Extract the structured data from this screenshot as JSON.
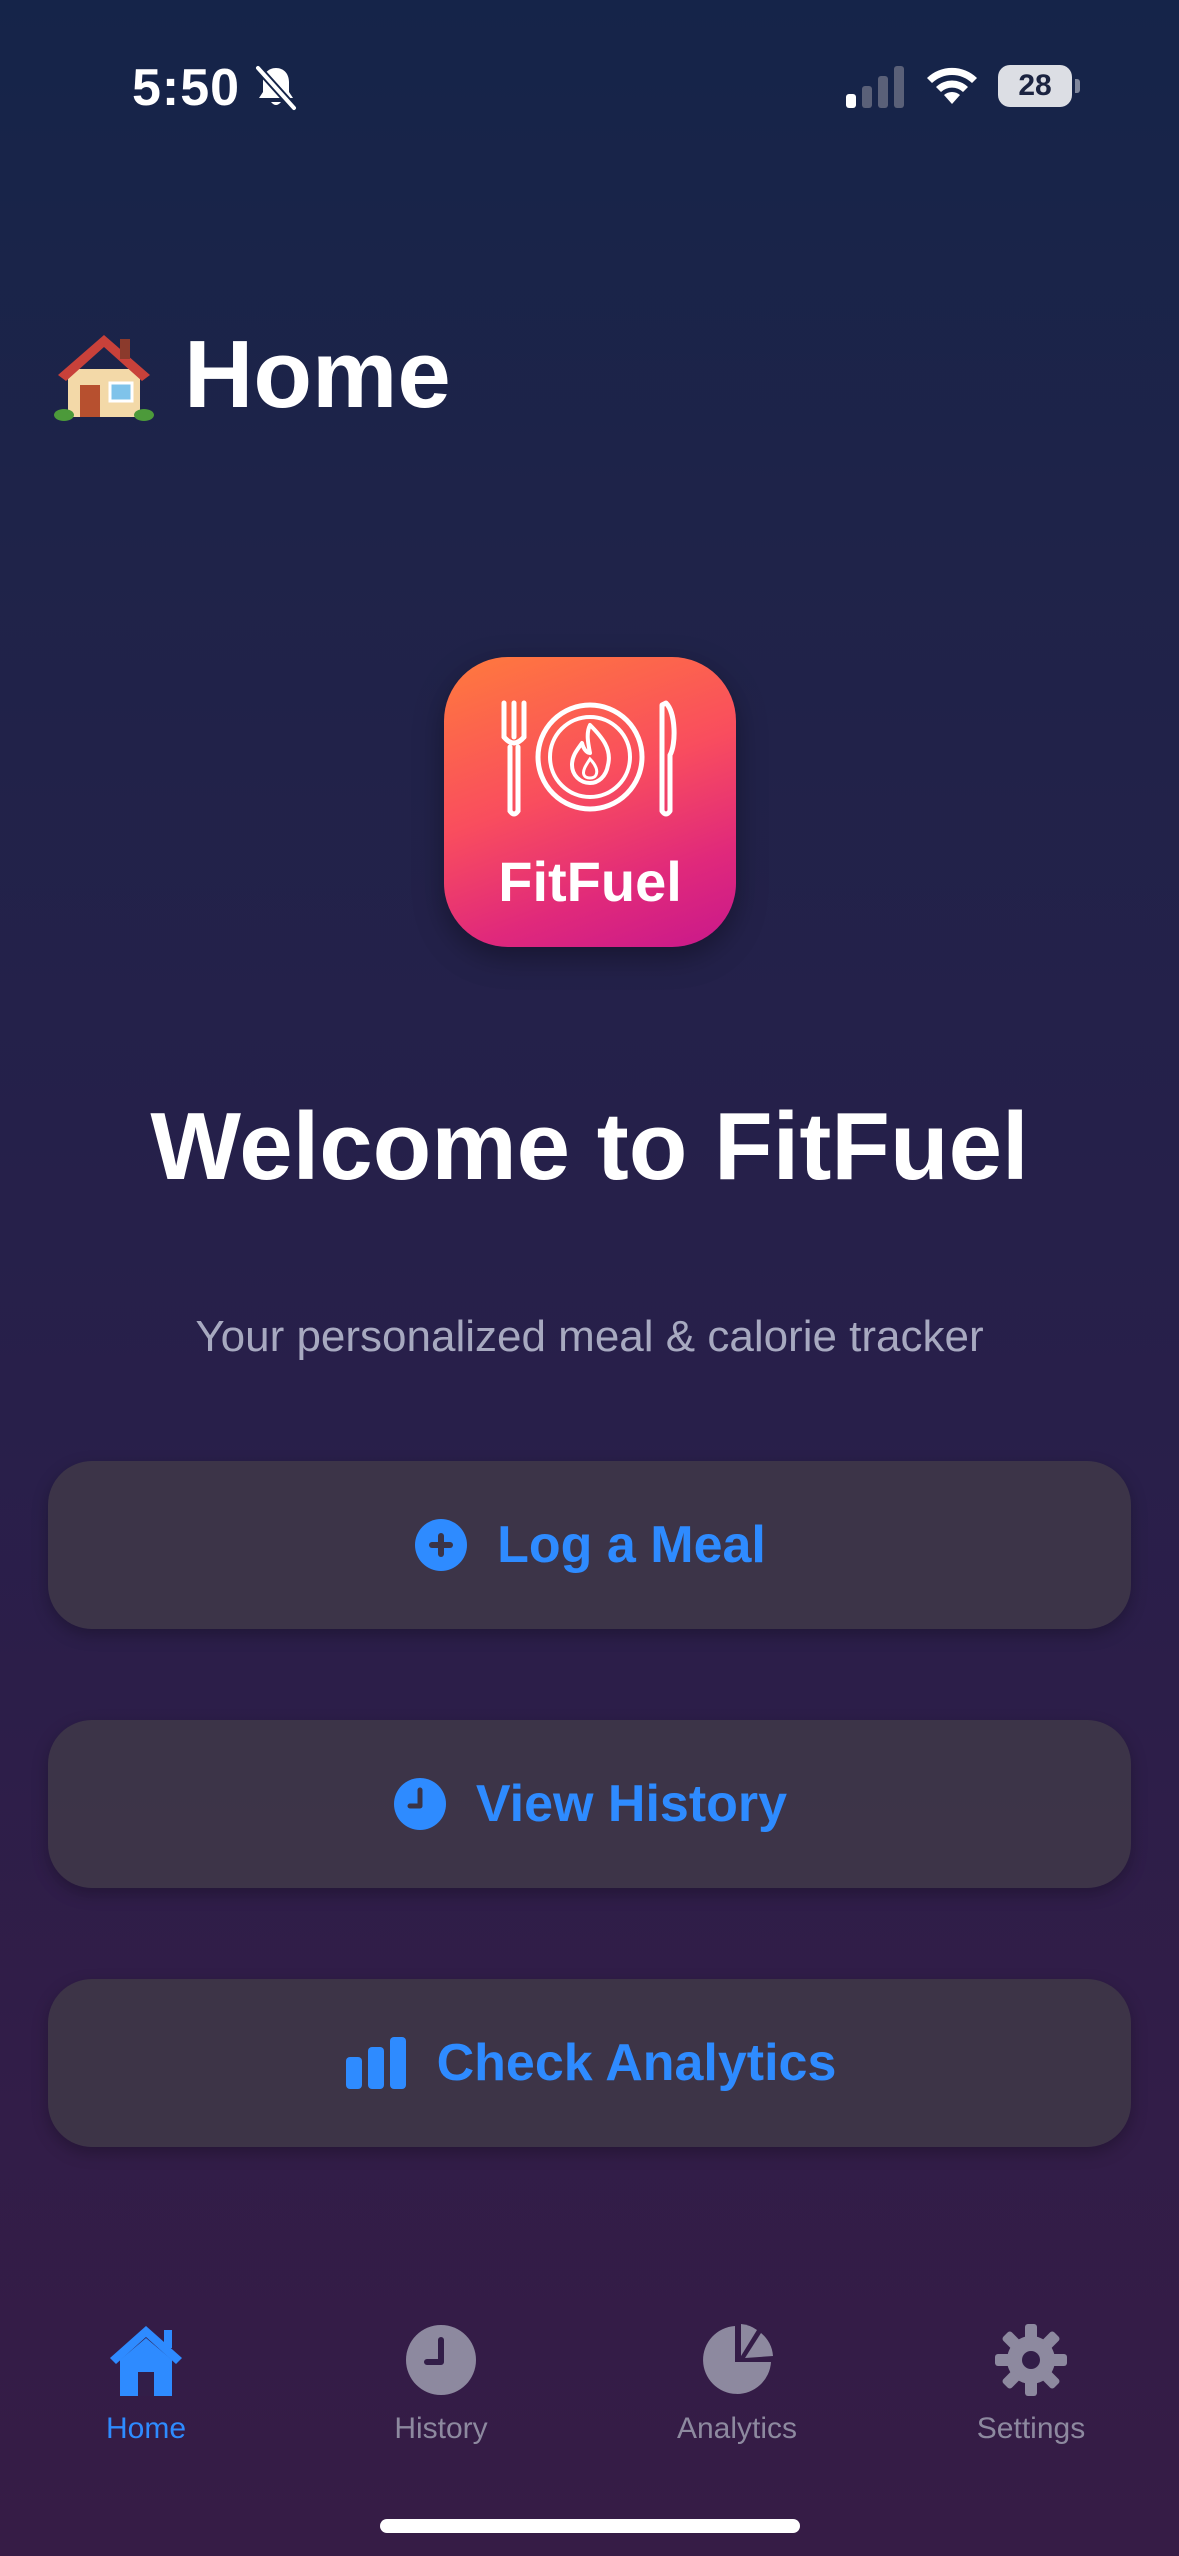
{
  "status_bar": {
    "time": "5:50",
    "battery_level": "28",
    "icons": [
      "bell-slash-icon",
      "cellular-signal-icon",
      "wifi-icon",
      "battery-icon"
    ]
  },
  "header": {
    "emoji": "house-emoji-icon",
    "title": "Home"
  },
  "app_icon": {
    "label": "FitFuel",
    "emblem": "plate-flame-cutlery-icon",
    "gradient": [
      "#ff7a3d",
      "#f94d5e",
      "#c8188c"
    ]
  },
  "welcome": {
    "title": "Welcome to FitFuel",
    "subtitle": "Your personalized meal & calorie tracker"
  },
  "actions": [
    {
      "label": "Log a Meal",
      "icon": "plus-circle-icon"
    },
    {
      "label": "View History",
      "icon": "clock-icon"
    },
    {
      "label": "Check Analytics",
      "icon": "bar-chart-icon"
    }
  ],
  "tab_bar": {
    "tabs": [
      {
        "label": "Home",
        "icon": "house-icon",
        "active": true
      },
      {
        "label": "History",
        "icon": "clock-icon",
        "active": false
      },
      {
        "label": "Analytics",
        "icon": "pie-chart-icon",
        "active": false
      },
      {
        "label": "Settings",
        "icon": "gear-icon",
        "active": false
      }
    ]
  },
  "colors": {
    "accent": "#2e8bff",
    "button_bg": "#403848",
    "inactive_tab": "#8d899f",
    "subtitle": "#a7a9c0",
    "background_top": "#152449",
    "background_bottom": "#361c46"
  }
}
